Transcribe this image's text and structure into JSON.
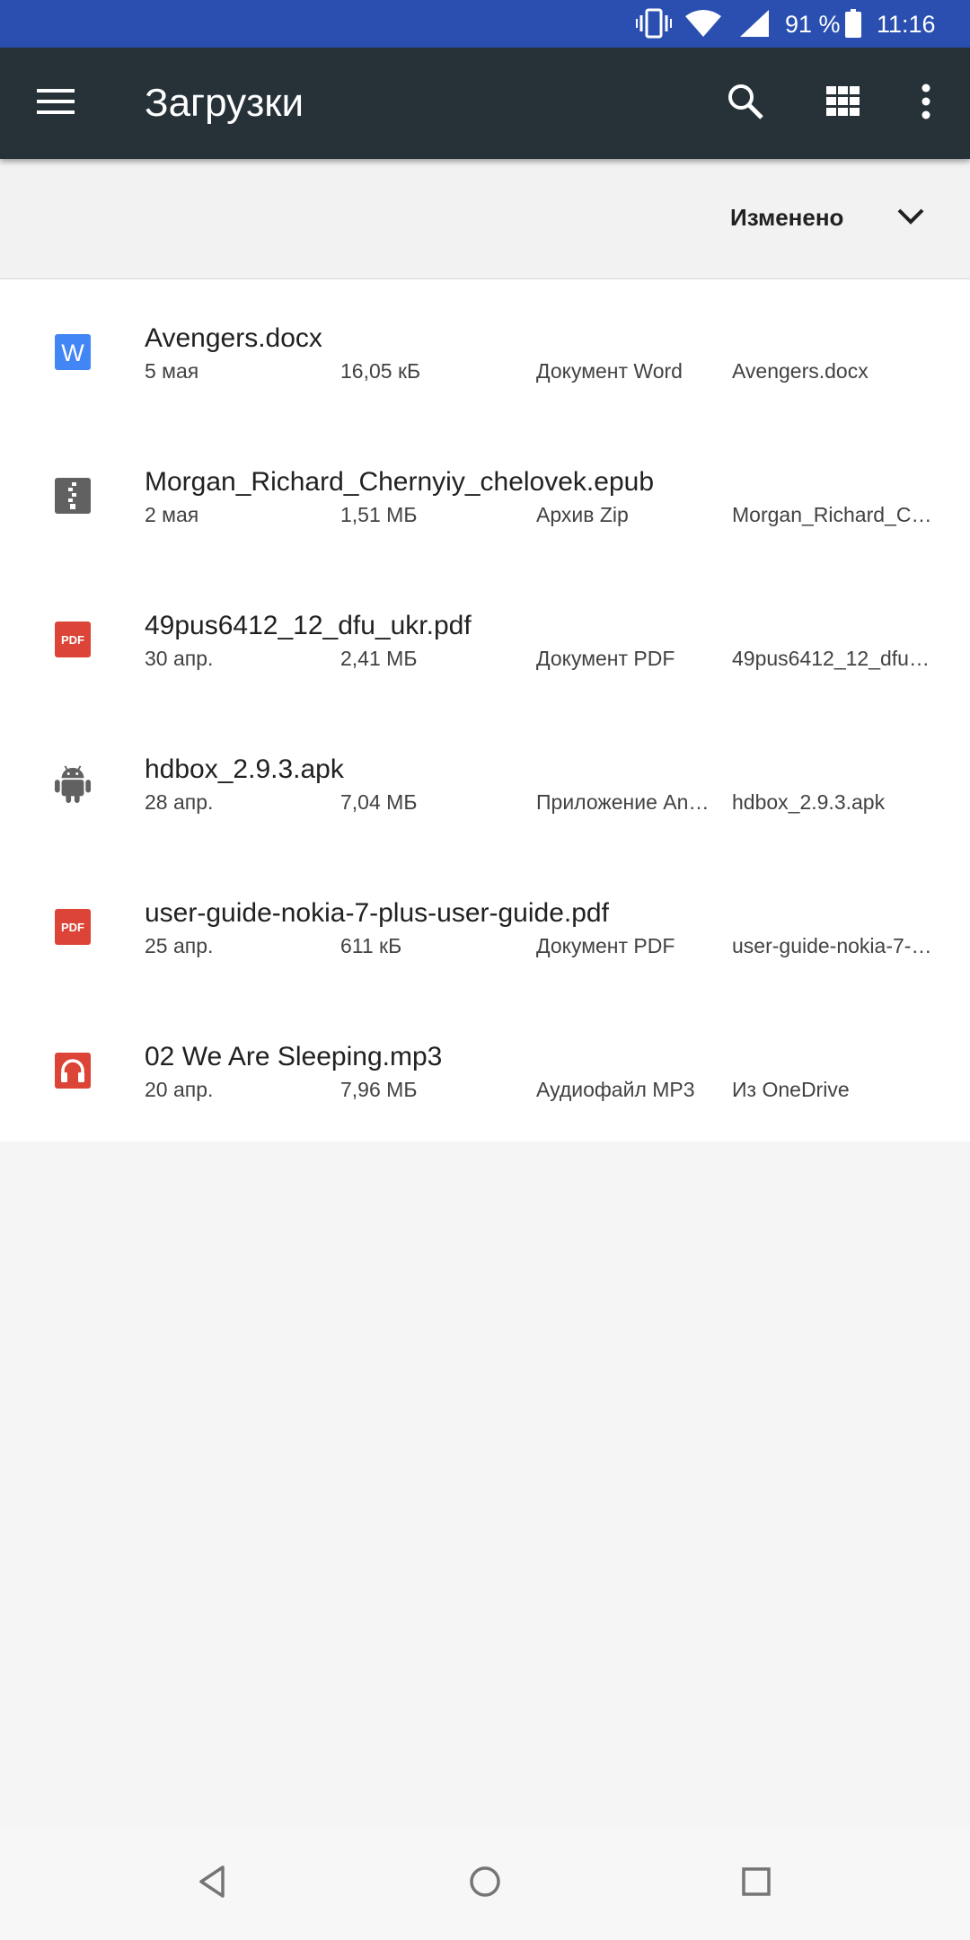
{
  "status_bar": {
    "battery": "91 %",
    "time": "11:16"
  },
  "app_bar": {
    "title": "Загрузки"
  },
  "sort_bar": {
    "label": "Изменено"
  },
  "files": [
    {
      "name": "Avengers.docx",
      "date": "5 мая",
      "size": "16,05 кБ",
      "type": "Документ Word",
      "summary": "Avengers.docx",
      "icon": "word-doc-icon",
      "icon_color": "#4285f4"
    },
    {
      "name": "Morgan_Richard_Chernyiy_chelovek.epub",
      "date": "2 мая",
      "size": "1,51 МБ",
      "type": "Архив Zip",
      "summary": "Morgan_Richard_Ch…",
      "icon": "zip-archive-icon",
      "icon_color": "#616161"
    },
    {
      "name": "49pus6412_12_dfu_ukr.pdf",
      "date": "30 апр.",
      "size": "2,41 МБ",
      "type": "Документ PDF",
      "summary": "49pus6412_12_dfu_…",
      "icon": "pdf-icon",
      "icon_color": "#db4437"
    },
    {
      "name": "hdbox_2.9.3.apk",
      "date": "28 апр.",
      "size": "7,04 МБ",
      "type": "Приложение And…",
      "summary": "hdbox_2.9.3.apk",
      "icon": "android-icon",
      "icon_color": "#616161"
    },
    {
      "name": "user-guide-nokia-7-plus-user-guide.pdf",
      "date": "25 апр.",
      "size": "611 кБ",
      "type": "Документ PDF",
      "summary": "user-guide-nokia-7-p…",
      "icon": "pdf-icon",
      "icon_color": "#db4437"
    },
    {
      "name": "02 We Are Sleeping.mp3",
      "date": "20 апр.",
      "size": "7,96 МБ",
      "type": "Аудиофайл MP3",
      "summary": "Из OneDrive",
      "icon": "audio-headphones-icon",
      "icon_color": "#db4437"
    }
  ],
  "colors": {
    "status_bar": "#2a4fb0",
    "app_bar": "#263238",
    "background": "#f5f5f5"
  }
}
